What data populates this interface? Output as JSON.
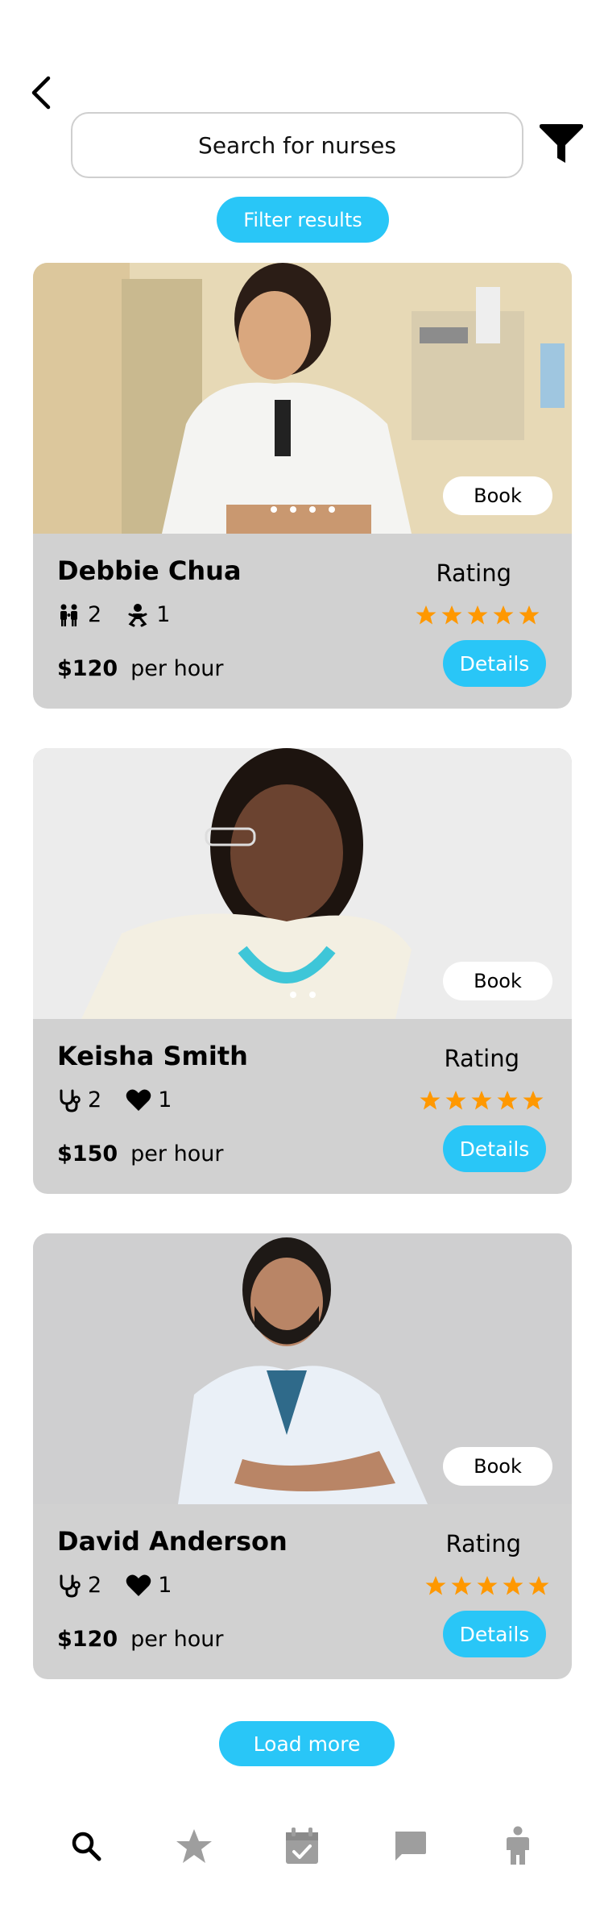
{
  "header": {
    "back_icon": "chevron-left-icon",
    "search_placeholder": "Search for nurses",
    "filter_icon": "funnel-icon",
    "filter_results_label": "Filter results"
  },
  "nurses": [
    {
      "name": "Debbie Chua",
      "stat1_value": "2",
      "stat1_icon": "family-icon",
      "stat2_value": "1",
      "stat2_icon": "baby-icon",
      "price": "$120",
      "price_unit": "per hour",
      "rating_label": "Rating",
      "rating": 5,
      "book_label": "Book",
      "details_label": "Details",
      "photo_dots": 4
    },
    {
      "name": "Keisha Smith",
      "stat1_value": "2",
      "stat1_icon": "stethoscope-icon",
      "stat2_value": "1",
      "stat2_icon": "heart-icon",
      "price": "$150",
      "price_unit": "per hour",
      "rating_label": "Rating",
      "rating": 5,
      "book_label": "Book",
      "details_label": "Details",
      "photo_dots": 2
    },
    {
      "name": "David Anderson",
      "stat1_value": "2",
      "stat1_icon": "stethoscope-icon",
      "stat2_value": "1",
      "stat2_icon": "heart-icon",
      "price": "$120",
      "price_unit": "per hour",
      "rating_label": "Rating",
      "rating": 5,
      "book_label": "Book",
      "details_label": "Details",
      "photo_dots": 0
    }
  ],
  "load_more_label": "Load more",
  "bottom_nav": {
    "items": [
      "search-icon",
      "star-icon",
      "calendar-check-icon",
      "chat-icon",
      "person-icon"
    ],
    "active": "search-icon"
  },
  "colors": {
    "accent": "#29c6f7",
    "card_bg": "#d1d1d1",
    "star": "#ff9800",
    "nav_inactive": "#9e9e9e"
  }
}
